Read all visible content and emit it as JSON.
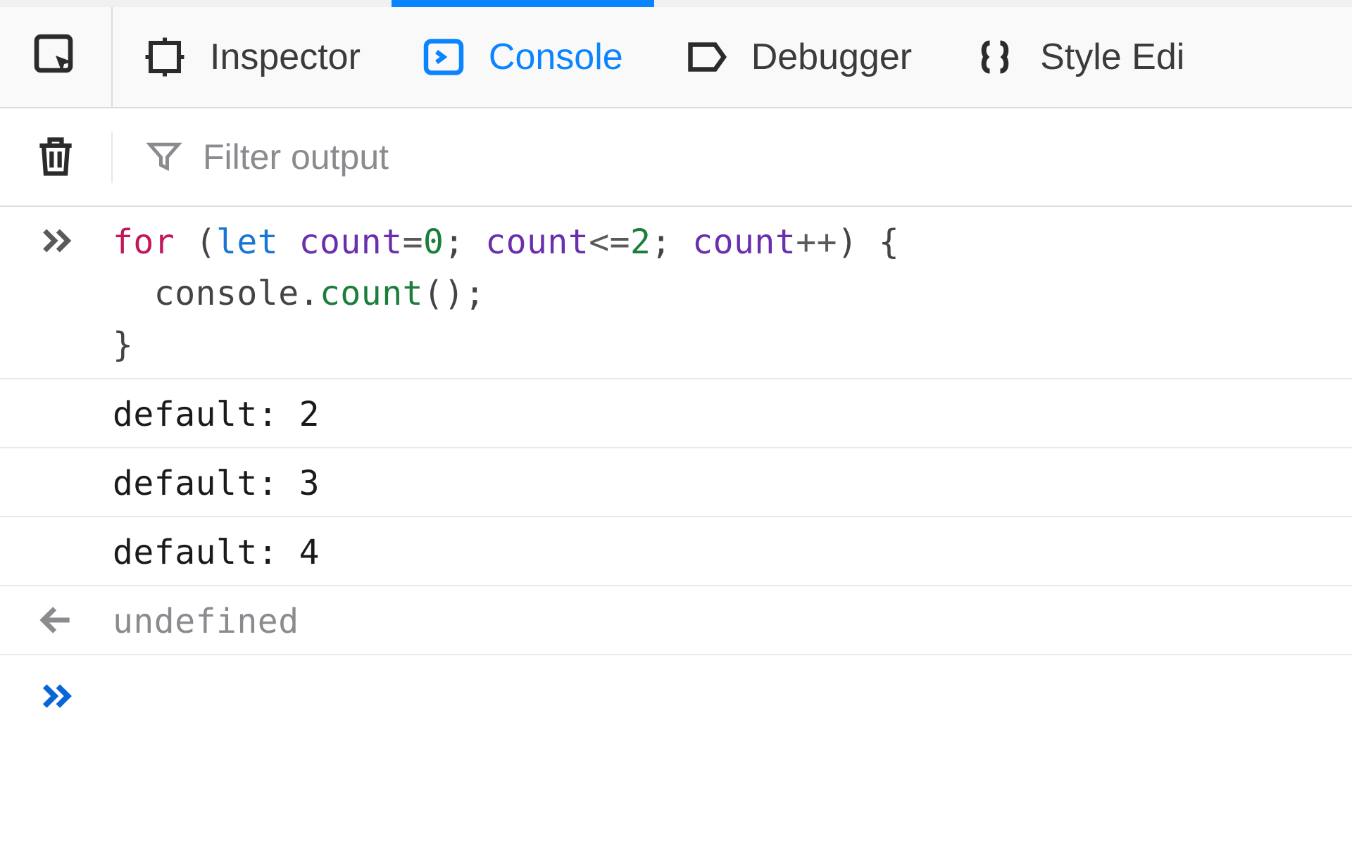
{
  "tabs": {
    "inspector": "Inspector",
    "console": "Console",
    "debugger": "Debugger",
    "style_editor": "Style Edi"
  },
  "toolbar": {
    "filter_placeholder": "Filter output"
  },
  "code": {
    "for": "for",
    "lparen": " (",
    "let": "let",
    "sp1": " ",
    "ident1": "count",
    "eq": "=",
    "zero": "0",
    "semi1": "; ",
    "ident2": "count",
    "le": "<=",
    "two": "2",
    "semi2": "; ",
    "ident3": "count",
    "pp": "++",
    "rparen_brace": ") {",
    "indent": "  ",
    "console_obj": "console",
    "dot": ".",
    "method": "count",
    "call": "();",
    "close_brace": "}"
  },
  "logs": [
    "default: 2",
    "default: 3",
    "default: 4"
  ],
  "return_value": "undefined"
}
